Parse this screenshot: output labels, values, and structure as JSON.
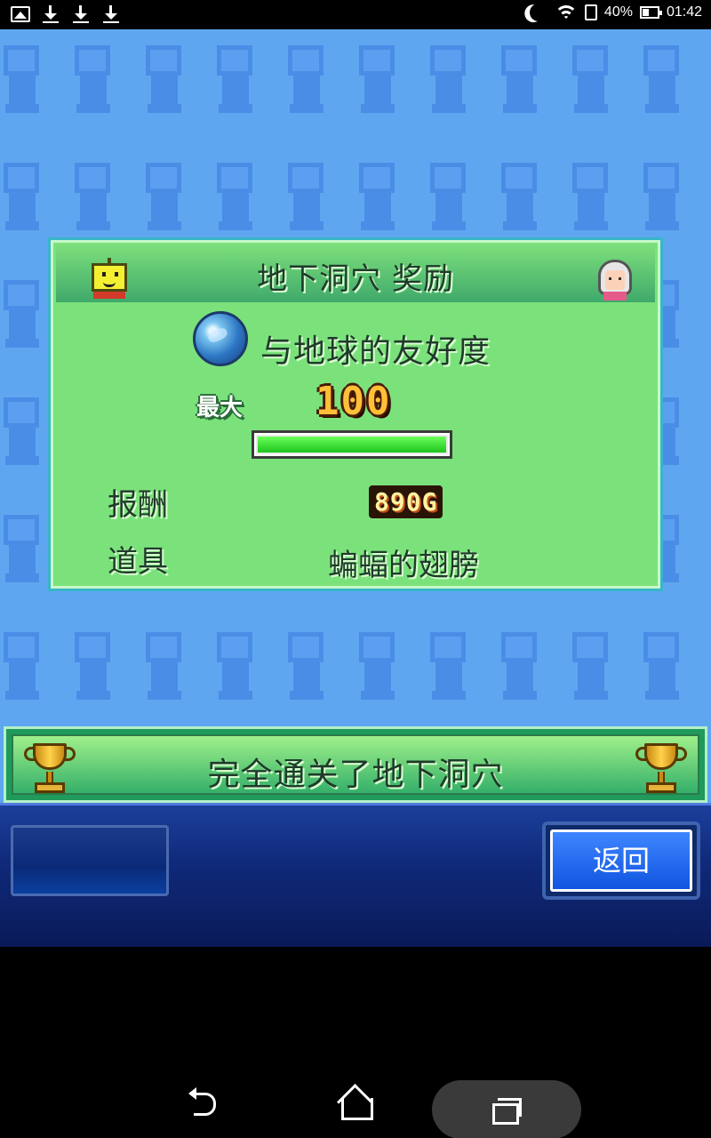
{
  "status_bar": {
    "left_icons": [
      "image-icon",
      "download-icon",
      "download-icon",
      "download-icon"
    ],
    "battery": "40%",
    "time": "01:42"
  },
  "panel": {
    "title": "地下洞穴 奖励",
    "subject": "与地球的友好度",
    "max_label": "最大",
    "max_value": "100",
    "progress": 1.0,
    "reward_label": "报酬",
    "reward_value": "890G",
    "item_label": "道具",
    "item_value": "蝙蝠的翅膀"
  },
  "banner": {
    "text": "完全通关了地下洞穴"
  },
  "bottom_bar": {
    "back_label": "返回"
  },
  "colors": {
    "background": "#5ea7f0",
    "panel": "#7be27b",
    "progress": "#2fe02a",
    "back_button": "#1f6bff"
  }
}
